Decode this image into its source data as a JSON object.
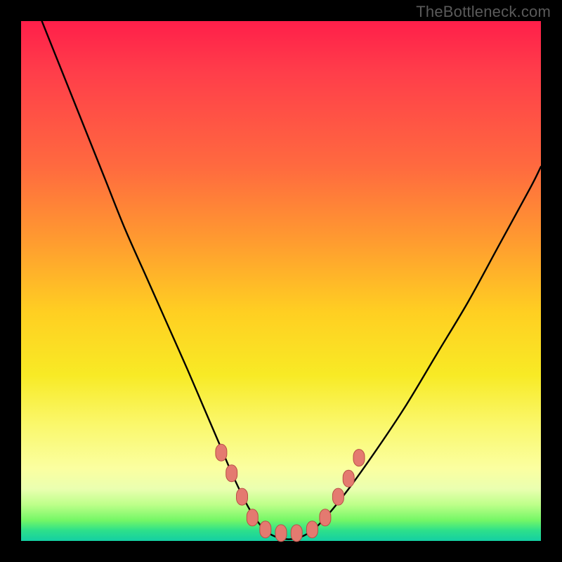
{
  "watermark": "TheBottleneck.com",
  "colors": {
    "background": "#000000",
    "gradient_top": "#ff1f4a",
    "gradient_mid": "#f8ea25",
    "gradient_bottom": "#14cfa3",
    "curve": "#000000",
    "marker_fill": "#e47a70",
    "marker_stroke": "#b84f45"
  },
  "chart_data": {
    "type": "line",
    "title": "",
    "xlabel": "",
    "ylabel": "",
    "xlim": [
      0,
      100
    ],
    "ylim": [
      0,
      100
    ],
    "grid": false,
    "legend": false,
    "annotations": [],
    "notes": "V-shaped bottleneck curve; y is mismatch percentage (0 at bottom = balanced, 100 at top = severe). Minimum (flat green zone) around x≈44–58. Values estimated from pixel positions.",
    "series": [
      {
        "name": "bottleneck-curve",
        "x": [
          4,
          8,
          12,
          16,
          20,
          24,
          28,
          32,
          35,
          38,
          41,
          44,
          47,
          50,
          53,
          56,
          59,
          63,
          68,
          74,
          80,
          86,
          92,
          98,
          100
        ],
        "y": [
          100,
          90,
          80,
          70,
          60,
          51,
          42,
          33,
          26,
          19,
          12,
          6,
          2,
          0.5,
          0.5,
          2,
          5,
          10,
          17,
          26,
          36,
          46,
          57,
          68,
          72
        ]
      }
    ],
    "markers": {
      "name": "highlight-dots",
      "note": "Pink lozenge markers near the trough on both sides and along the flat bottom",
      "points": [
        {
          "x": 38.5,
          "y": 17
        },
        {
          "x": 40.5,
          "y": 13
        },
        {
          "x": 42.5,
          "y": 8.5
        },
        {
          "x": 44.5,
          "y": 4.5
        },
        {
          "x": 47.0,
          "y": 2.2
        },
        {
          "x": 50.0,
          "y": 1.5
        },
        {
          "x": 53.0,
          "y": 1.5
        },
        {
          "x": 56.0,
          "y": 2.2
        },
        {
          "x": 58.5,
          "y": 4.5
        },
        {
          "x": 61.0,
          "y": 8.5
        },
        {
          "x": 63.0,
          "y": 12
        },
        {
          "x": 65.0,
          "y": 16
        }
      ]
    }
  }
}
